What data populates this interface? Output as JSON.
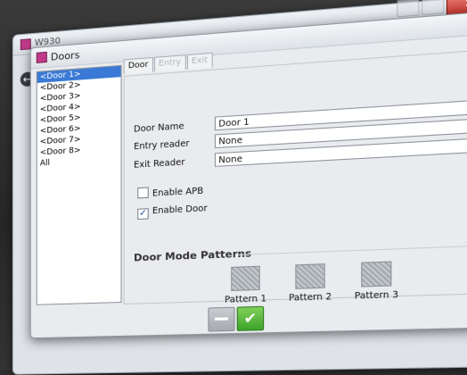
{
  "back_window": {
    "title": "W930",
    "close_glyph": "✕"
  },
  "dialog": {
    "title": "Doors",
    "door_list": [
      "<Door 1>",
      "<Door 2>",
      "<Door 3>",
      "<Door 4>",
      "<Door 5>",
      "<Door 6>",
      "<Door 7>",
      "<Door 8>",
      "All"
    ],
    "selected_index": 0,
    "tabs": [
      {
        "label": "Door",
        "enabled": true
      },
      {
        "label": "Entry",
        "enabled": false
      },
      {
        "label": "Exit",
        "enabled": false
      }
    ],
    "door_name_label": "Door Name",
    "door_name_value": "Door 1",
    "entry_reader_label": "Entry reader",
    "entry_reader_value": "None",
    "exit_reader_label": "Exit Reader",
    "exit_reader_value": "None",
    "enable_apb_label": "Enable APB",
    "enable_apb_checked": false,
    "enable_door_label": "Enable Door",
    "enable_door_checked": true,
    "door_mode_title": "Door Mode Patterns",
    "patterns": [
      "Pattern 1",
      "Pattern 2",
      "Pattern 3"
    ]
  },
  "colors": {
    "selection": "#3a7ad6",
    "ok_green": "#3ea32a",
    "close_red": "#c4302a"
  }
}
